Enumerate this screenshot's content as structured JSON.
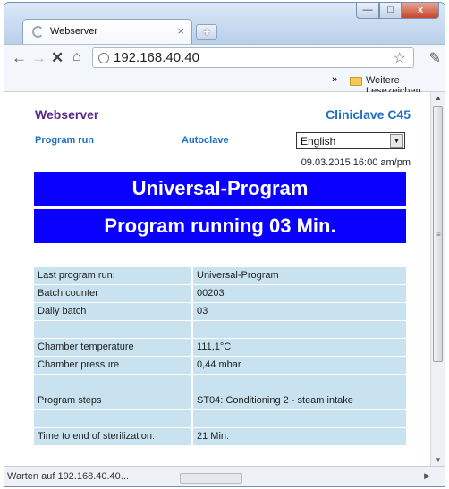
{
  "browser": {
    "tab_title": "Webserver",
    "tab_close": "×",
    "new_tab": "+",
    "url": "192.168.40.40",
    "bookmarks_more": "»",
    "bookmarks_folder": "Weitere Lesezeichen",
    "window_minimize": "—",
    "window_maximize": "□",
    "window_close": "x",
    "status": "Warten auf 192.168.40.40..."
  },
  "page": {
    "header_left": "Webserver",
    "header_right": "Cliniclave  C45",
    "nav_program_run": "Program run",
    "nav_autoclave": "Autoclave",
    "language_selected": "English",
    "datetime": "09.03.2015   16:00 am/pm",
    "banner_program": "Universal-Program",
    "banner_status": "Program running 03 Min."
  },
  "info_rows": [
    {
      "label": "Last program run:",
      "value": "Universal-Program"
    },
    {
      "label": "Batch counter",
      "value": "00203"
    },
    {
      "label": "Daily batch",
      "value": "03"
    },
    {
      "label": "",
      "value": ""
    },
    {
      "label": "Chamber temperature",
      "value": "111,1°C"
    },
    {
      "label": "Chamber pressure",
      "value": "0,44 mbar"
    },
    {
      "label": "",
      "value": ""
    },
    {
      "label": "Program steps",
      "value": "ST04: Conditioning 2 - steam intake"
    },
    {
      "label": "",
      "value": ""
    },
    {
      "label": "Time to end of sterilization:",
      "value": "21 Min."
    }
  ],
  "colors": {
    "banner_bg": "#0a00ff",
    "row_bg": "#c8e3ef",
    "header_left": "#5a2a8a",
    "link": "#1e6fc4"
  },
  "icons": [
    "back-arrow-icon",
    "forward-arrow-icon",
    "stop-icon",
    "home-icon",
    "globe-icon",
    "star-icon",
    "wrench-icon",
    "folder-icon",
    "chevron-down-icon"
  ]
}
